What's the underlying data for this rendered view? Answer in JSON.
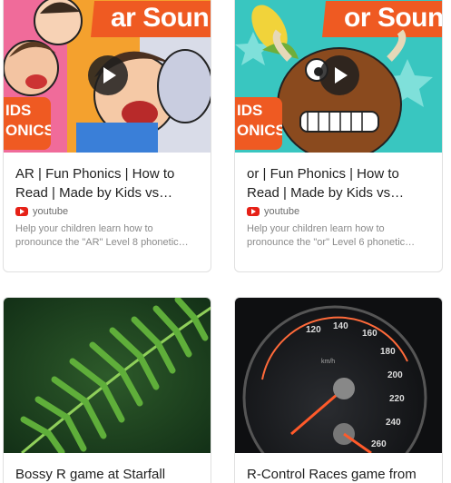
{
  "cards": [
    {
      "thumb_text": "ar Soun",
      "badge_line1": "IDS",
      "badge_line2": "ONICS",
      "title": "AR | Fun Phonics | How to Read | Made by Kids vs…",
      "source": "youtube",
      "description": "Help your children learn how to pronounce the \"AR\" Level 8 phonetic…"
    },
    {
      "thumb_text": "or Soun",
      "badge_line1": "IDS",
      "badge_line2": "ONICS",
      "title": "or | Fun Phonics | How to Read | Made by Kids vs…",
      "source": "youtube",
      "description": "Help your children learn how to pronounce the \"or\" Level 6 phonetic…"
    },
    {
      "title": "Bossy R game at Starfall"
    },
    {
      "title": "R-Control Races game from"
    }
  ],
  "colors": {
    "banner_orange": "#ef5a22",
    "youtube_red": "#e62117"
  }
}
